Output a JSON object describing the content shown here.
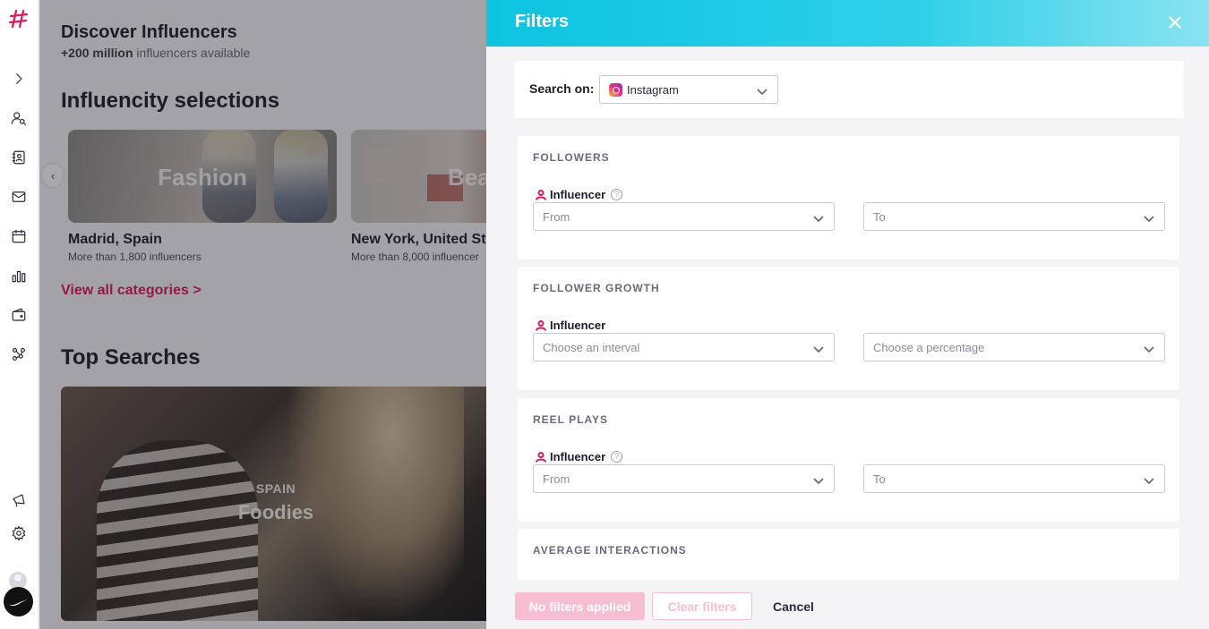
{
  "colors": {
    "accent": "#e0185f",
    "header_cyan": "#0cc3e0",
    "disabled_pink": "#f7bdd1"
  },
  "sidenav": {
    "items": [
      {
        "name": "logo-icon"
      },
      {
        "name": "expand-icon"
      },
      {
        "name": "discover-icon"
      },
      {
        "name": "contacts-icon"
      },
      {
        "name": "mail-icon"
      },
      {
        "name": "calendar-icon"
      },
      {
        "name": "analytics-icon"
      },
      {
        "name": "wallet-icon"
      },
      {
        "name": "network-icon"
      },
      {
        "name": "megaphone-icon"
      },
      {
        "name": "settings-icon"
      }
    ]
  },
  "main": {
    "title": "Discover Influencers",
    "subtitle_bold": "+200 million",
    "subtitle_rest": " influencers available",
    "selections_title": "Influencity selections",
    "cards": [
      {
        "image_label": "Fashion",
        "city": "Madrid, Spain",
        "count": "More than 1,800 influencers"
      },
      {
        "image_label": "Bea",
        "city": "New York, United St",
        "count": "More than 8,000 influencer"
      }
    ],
    "view_all": "View all categories >",
    "top_searches_title": "Top Searches",
    "top_search": {
      "country": "SPAIN",
      "category": "Foodies"
    }
  },
  "filters": {
    "title": "Filters",
    "search_on_label": "Search on:",
    "platform": "Instagram",
    "sections": [
      {
        "title": "FOLLOWERS",
        "sub_label": "Influencer",
        "help": true,
        "left_placeholder": "From",
        "right_placeholder": "To"
      },
      {
        "title": "FOLLOWER GROWTH",
        "sub_label": "Influencer",
        "help": false,
        "left_placeholder": "Choose an interval",
        "right_placeholder": "Choose a percentage"
      },
      {
        "title": "REEL PLAYS",
        "sub_label": "Influencer",
        "help": true,
        "left_placeholder": "From",
        "right_placeholder": "To"
      },
      {
        "title": "AVERAGE INTERACTIONS"
      }
    ],
    "footer": {
      "apply_label": "No filters applied",
      "clear_label": "Clear filters",
      "cancel_label": "Cancel"
    }
  }
}
